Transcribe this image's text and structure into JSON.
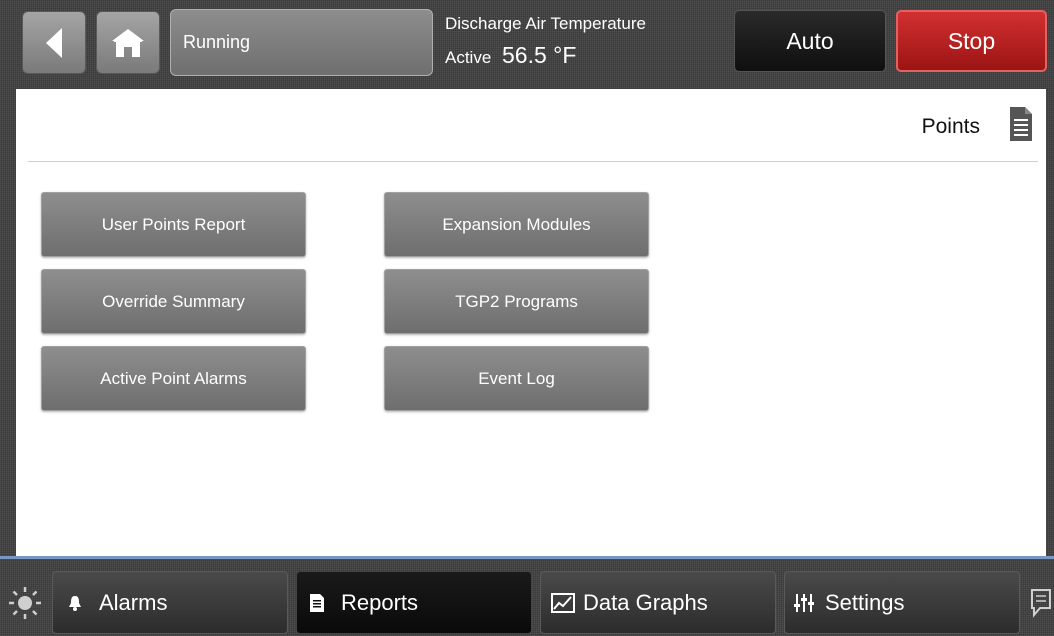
{
  "header": {
    "status_text": "Running",
    "readout_label": "Discharge Air Temperature",
    "readout_state": "Active",
    "readout_value": "56.5 °F",
    "mode_auto_label": "Auto",
    "mode_stop_label": "Stop"
  },
  "panel": {
    "title": "Points",
    "buttons_left": [
      "User Points Report",
      "Override Summary",
      "Active Point Alarms"
    ],
    "buttons_right": [
      "Expansion Modules",
      "TGP2 Programs",
      "Event Log"
    ]
  },
  "tabs": [
    {
      "label": "Alarms",
      "icon": "bell-icon"
    },
    {
      "label": "Reports",
      "icon": "document-icon"
    },
    {
      "label": "Data Graphs",
      "icon": "chart-icon"
    },
    {
      "label": "Settings",
      "icon": "sliders-icon"
    }
  ],
  "colors": {
    "stop_red": "#b81e1e",
    "auto_black": "#1a1a1a",
    "accent_line": "#7a96c2"
  }
}
